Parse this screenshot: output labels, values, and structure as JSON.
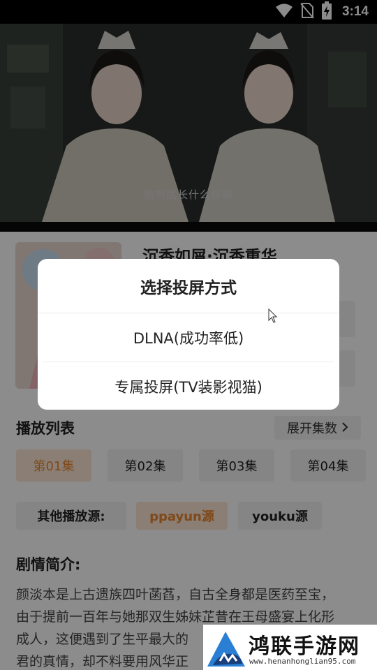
{
  "status_bar": {
    "time": "3:14",
    "icons": [
      "wifi-icon",
      "no-sim-icon",
      "battery-charging-icon"
    ]
  },
  "video": {
    "subtitle": "他到底长什么样啊"
  },
  "show": {
    "title": "沉香如屑·沉香重华"
  },
  "playlist": {
    "title": "播放列表",
    "expand_label": "展开集数",
    "episodes": [
      "第01集",
      "第02集",
      "第03集",
      "第04集"
    ],
    "active_episode": "第01集"
  },
  "sources": {
    "label": "其他播放源:",
    "items": [
      "ppayun源",
      "youku源"
    ],
    "active": "ppayun源"
  },
  "synopsis": {
    "title": "剧情简介:",
    "lines": [
      "颜淡本是上古遗族四叶菡萏，自古全身都是医药至宝，",
      "由于提前一百年与她那双生姊妹芷昔在王母盛宴上化形",
      "成人，这便遇到了生平最大的",
      "君的真情，却不料要用风华正"
    ]
  },
  "dialog": {
    "title": "选择投屏方式",
    "options": [
      "DLNA(成功率低)",
      "专属投屏(TV装影视猫)"
    ]
  },
  "watermark": {
    "text": "鸿联手游网",
    "url": "www.henanhonglian95.com"
  },
  "colors": {
    "accent": "#e8852e",
    "accent_bg": "#fbe6d6",
    "chip_bg": "#f2f2f2",
    "overlay": "rgba(0,0,0,0.45)"
  }
}
